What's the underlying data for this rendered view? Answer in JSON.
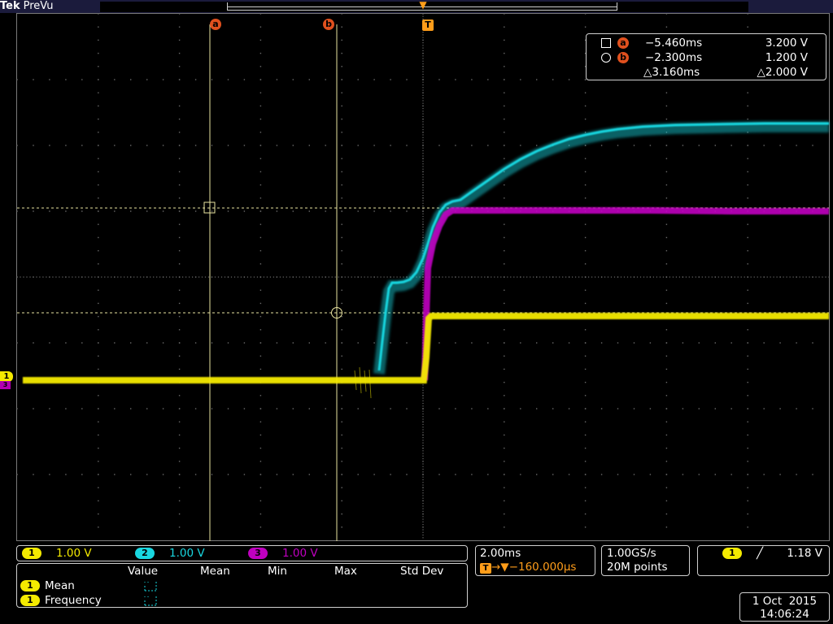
{
  "brand": {
    "tek": "Tek",
    "mode": "PreVu"
  },
  "colors": {
    "ch1": "#f4ea00",
    "ch2": "#19d7e0",
    "ch3": "#c000c0",
    "cursor": "#e0501e",
    "trigger": "#ff9d1a",
    "graticule": "#7a7a7a"
  },
  "markers": {
    "cursor_a": "a",
    "cursor_b": "b",
    "trigger": "T",
    "ch1_level": "1",
    "ch3_level": "3"
  },
  "cursor_readout": {
    "a": {
      "label": "a",
      "time": "−5.460ms",
      "value": "3.200 V"
    },
    "b": {
      "label": "b",
      "time": "−2.300ms",
      "value": "1.200 V"
    },
    "delta": {
      "time": "△3.160ms",
      "value": "△2.000 V"
    }
  },
  "channels": [
    {
      "id": "1",
      "scale": "1.00 V",
      "color": "#f4ea00"
    },
    {
      "id": "2",
      "scale": "1.00 V",
      "color": "#19d7e0"
    },
    {
      "id": "3",
      "scale": "1.00 V",
      "color": "#c000c0"
    }
  ],
  "timebase": {
    "scale": "2.00ms",
    "position": "→▼−160.000µs",
    "trigger_icon": "T"
  },
  "acquisition": {
    "rate": "1.00GS/s",
    "length": "20M points"
  },
  "trigger": {
    "source": "1",
    "slope_icon": "rising-edge-icon",
    "slope_glyph": "╱",
    "level": "1.18 V"
  },
  "measurements": {
    "headers": [
      "Value",
      "Mean",
      "Min",
      "Max",
      "Std Dev"
    ],
    "rows": [
      {
        "channel": "1",
        "label": "Mean"
      },
      {
        "channel": "1",
        "label": "Frequency"
      }
    ]
  },
  "datetime": {
    "date": "1 Oct  2015",
    "time": "14:06:24"
  }
}
